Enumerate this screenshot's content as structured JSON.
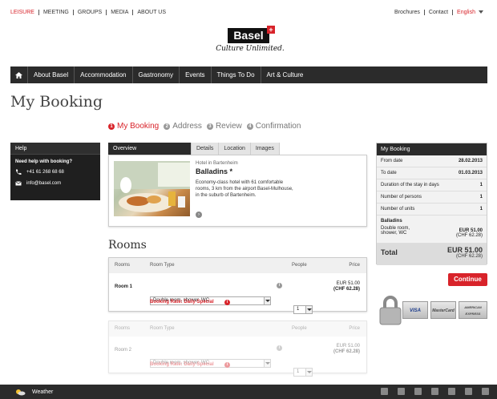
{
  "top_nav": [
    "LEISURE",
    "MEETING",
    "GROUPS",
    "MEDIA",
    "ABOUT US"
  ],
  "top_links": [
    "Brochures",
    "Contact"
  ],
  "language": "English",
  "logo": {
    "name": "Basel",
    "tagline": "Culture Unlimited."
  },
  "main_nav": [
    "About Basel",
    "Accommodation",
    "Gastronomy",
    "Events",
    "Things To Do",
    "Art & Culture"
  ],
  "page_title": "My Booking",
  "steps": [
    {
      "num": "1",
      "label": "My Booking"
    },
    {
      "num": "2",
      "label": "Address"
    },
    {
      "num": "3",
      "label": "Review"
    },
    {
      "num": "4",
      "label": "Confirmation"
    }
  ],
  "help": {
    "title": "Help",
    "question": "Need help with booking?",
    "phone": "+41 61 268 68 68",
    "email": "info@basel.com"
  },
  "hotel_tabs": [
    "Overview",
    "Details",
    "Location",
    "Images"
  ],
  "hotel": {
    "location": "Hotel in Bartenheim",
    "name": "Balladins *",
    "description": "Economy-class hotel with 61 comfortable rooms, 3 km from the airport Basel-Mulhouse, in the suburb of Bartenheim."
  },
  "rooms_title": "Rooms",
  "room_headers": {
    "rooms": "Rooms",
    "room_type": "Room Type",
    "people": "People",
    "price": "Price"
  },
  "rooms": [
    {
      "label": "Room 1",
      "type": "Double room, shower, WC",
      "people": "1",
      "rate": "Booking Rate: Daily-Special",
      "price_eur": "EUR 51.00",
      "price_chf": "(CHF 62.28)"
    },
    {
      "label": "Room 2",
      "type": "Double room, shower, WC",
      "people": "1",
      "rate": "Booking Rate: Daily-Special",
      "price_eur": "EUR 51.00",
      "price_chf": "(CHF 62.28)"
    }
  ],
  "summary": {
    "title": "My Booking",
    "rows": [
      {
        "label": "From date",
        "value": "28.02.2013"
      },
      {
        "label": "To date",
        "value": "01.03.2013"
      },
      {
        "label": "Duration of the stay in days",
        "value": "1"
      },
      {
        "label": "Number of persons",
        "value": "1"
      },
      {
        "label": "Number of units",
        "value": "1"
      }
    ],
    "hotel_name": "Balladins",
    "room_line1": "Double room,",
    "room_line2": "shower, WC",
    "room_eur": "EUR 51.00",
    "room_chf": "(CHF 62.28)",
    "total_label": "Total",
    "total_eur": "EUR 51.00",
    "total_chf": "(CHF 62.28)"
  },
  "continue_label": "Continue",
  "cards": [
    "VISA",
    "MasterCard",
    "AMERICAN EXPRESS"
  ],
  "weather_label": "Weather",
  "colors": {
    "accent": "#d8232a",
    "dark": "#2b2b2b"
  }
}
